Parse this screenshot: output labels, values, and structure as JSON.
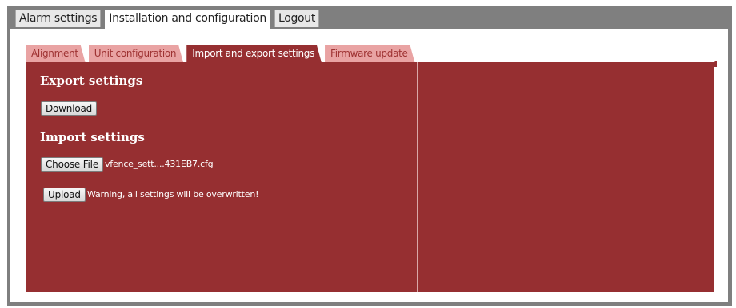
{
  "top_tabs": [
    {
      "label": "Alarm settings"
    },
    {
      "label": "Installation and configuration"
    },
    {
      "label": "Logout"
    }
  ],
  "sub_tabs": [
    {
      "label": "Alignment"
    },
    {
      "label": "Unit configuration"
    },
    {
      "label": "Import and export settings"
    },
    {
      "label": "Firmware update"
    }
  ],
  "export": {
    "title": "Export settings",
    "download_label": "Download"
  },
  "import": {
    "title": "Import settings",
    "choose_file_label": "Choose File",
    "file_name": "vfence_sett....431EB7.cfg",
    "upload_label": "Upload",
    "warning": "Warning, all settings will be overwritten!"
  },
  "colors": {
    "panel_bg": "#962f31",
    "inactive_tab_bg": "#e9a3a3",
    "frame": "#7f7f7f"
  }
}
